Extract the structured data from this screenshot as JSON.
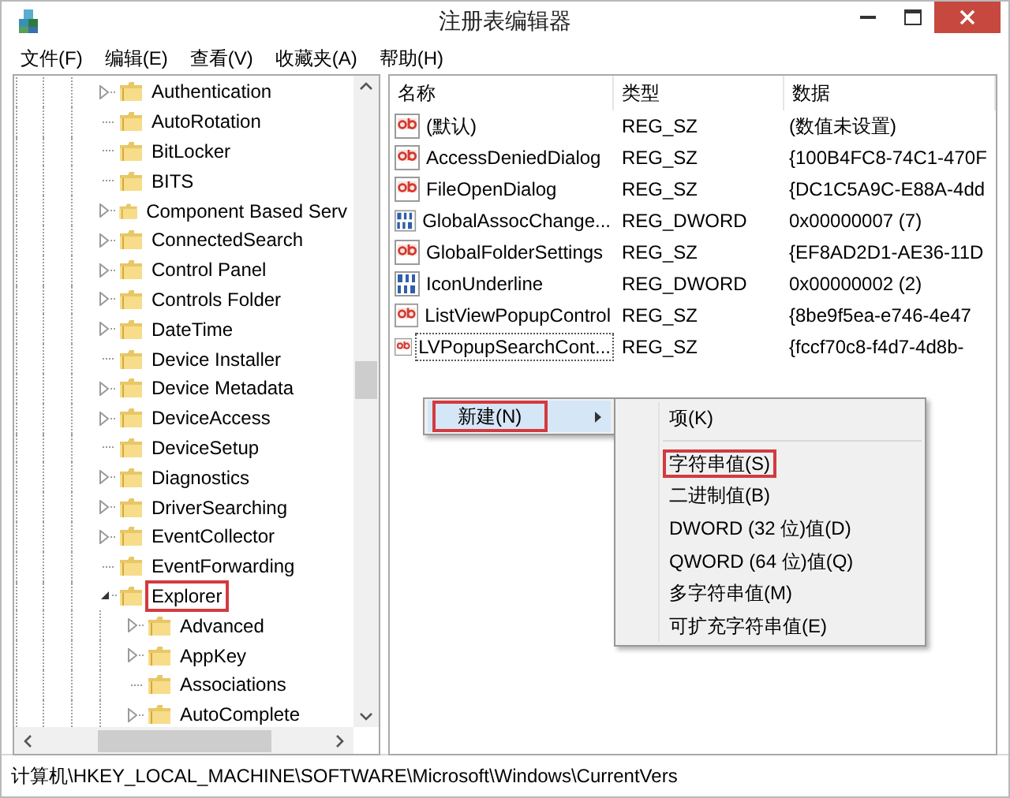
{
  "window": {
    "title": "注册表编辑器"
  },
  "menu_bar": [
    "文件(F)",
    "编辑(E)",
    "查看(V)",
    "收藏夹(A)",
    "帮助(H)"
  ],
  "tree": [
    {
      "label": "Authentication",
      "expandable": true,
      "expanded": false
    },
    {
      "label": "AutoRotation",
      "expandable": false
    },
    {
      "label": "BitLocker",
      "expandable": false
    },
    {
      "label": "BITS",
      "expandable": false
    },
    {
      "label": "Component Based Serv",
      "expandable": true,
      "expanded": false
    },
    {
      "label": "ConnectedSearch",
      "expandable": true,
      "expanded": false
    },
    {
      "label": "Control Panel",
      "expandable": true,
      "expanded": false
    },
    {
      "label": "Controls Folder",
      "expandable": true,
      "expanded": false
    },
    {
      "label": "DateTime",
      "expandable": true,
      "expanded": false
    },
    {
      "label": "Device Installer",
      "expandable": false
    },
    {
      "label": "Device Metadata",
      "expandable": true,
      "expanded": false
    },
    {
      "label": "DeviceAccess",
      "expandable": true,
      "expanded": false
    },
    {
      "label": "DeviceSetup",
      "expandable": false
    },
    {
      "label": "Diagnostics",
      "expandable": true,
      "expanded": false
    },
    {
      "label": "DriverSearching",
      "expandable": true,
      "expanded": false
    },
    {
      "label": "EventCollector",
      "expandable": true,
      "expanded": false
    },
    {
      "label": "EventForwarding",
      "expandable": false
    },
    {
      "label": "Explorer",
      "expandable": true,
      "expanded": true,
      "highlighted": true,
      "children": [
        {
          "label": "Advanced",
          "expandable": true,
          "expanded": false
        },
        {
          "label": "AppKey",
          "expandable": true,
          "expanded": false
        },
        {
          "label": "Associations",
          "expandable": false
        },
        {
          "label": "AutoComplete",
          "expandable": true,
          "expanded": false
        }
      ]
    }
  ],
  "values": {
    "columns": [
      "名称",
      "类型",
      "数据"
    ],
    "rows": [
      {
        "kind": "string",
        "name": "(默认)",
        "type": "REG_SZ",
        "data": "(数值未设置)",
        "focused": false
      },
      {
        "kind": "string",
        "name": "AccessDeniedDialog",
        "type": "REG_SZ",
        "data": "{100B4FC8-74C1-470F",
        "focused": false
      },
      {
        "kind": "string",
        "name": "FileOpenDialog",
        "type": "REG_SZ",
        "data": "{DC1C5A9C-E88A-4dd",
        "focused": false
      },
      {
        "kind": "dword",
        "name": "GlobalAssocChange...",
        "type": "REG_DWORD",
        "data": "0x00000007 (7)",
        "focused": false
      },
      {
        "kind": "string",
        "name": "GlobalFolderSettings",
        "type": "REG_SZ",
        "data": "{EF8AD2D1-AE36-11D",
        "focused": false
      },
      {
        "kind": "dword",
        "name": "IconUnderline",
        "type": "REG_DWORD",
        "data": "0x00000002 (2)",
        "focused": false
      },
      {
        "kind": "string",
        "name": "ListViewPopupControl",
        "type": "REG_SZ",
        "data": "{8be9f5ea-e746-4e47",
        "focused": false
      },
      {
        "kind": "string",
        "name": "LVPopupSearchCont...",
        "type": "REG_SZ",
        "data": "{fccf70c8-f4d7-4d8b-",
        "focused": true
      }
    ]
  },
  "context_menu": {
    "items": [
      {
        "label": "新建(N)",
        "has_submenu": true,
        "hovered": true,
        "highlighted": true
      }
    ]
  },
  "submenu": {
    "items": [
      {
        "kind": "item",
        "label": "项(K)",
        "highlighted": false
      },
      {
        "kind": "separator"
      },
      {
        "kind": "item",
        "label": "字符串值(S)",
        "highlighted": true
      },
      {
        "kind": "item",
        "label": "二进制值(B)",
        "highlighted": false
      },
      {
        "kind": "item",
        "label": "DWORD (32 位)值(D)",
        "highlighted": false
      },
      {
        "kind": "item",
        "label": "QWORD (64 位)值(Q)",
        "highlighted": false
      },
      {
        "kind": "item",
        "label": "多字符串值(M)",
        "highlighted": false
      },
      {
        "kind": "item",
        "label": "可扩充字符串值(E)",
        "highlighted": false
      }
    ]
  },
  "status_bar": "计算机\\HKEY_LOCAL_MACHINE\\SOFTWARE\\Microsoft\\Windows\\CurrentVers"
}
